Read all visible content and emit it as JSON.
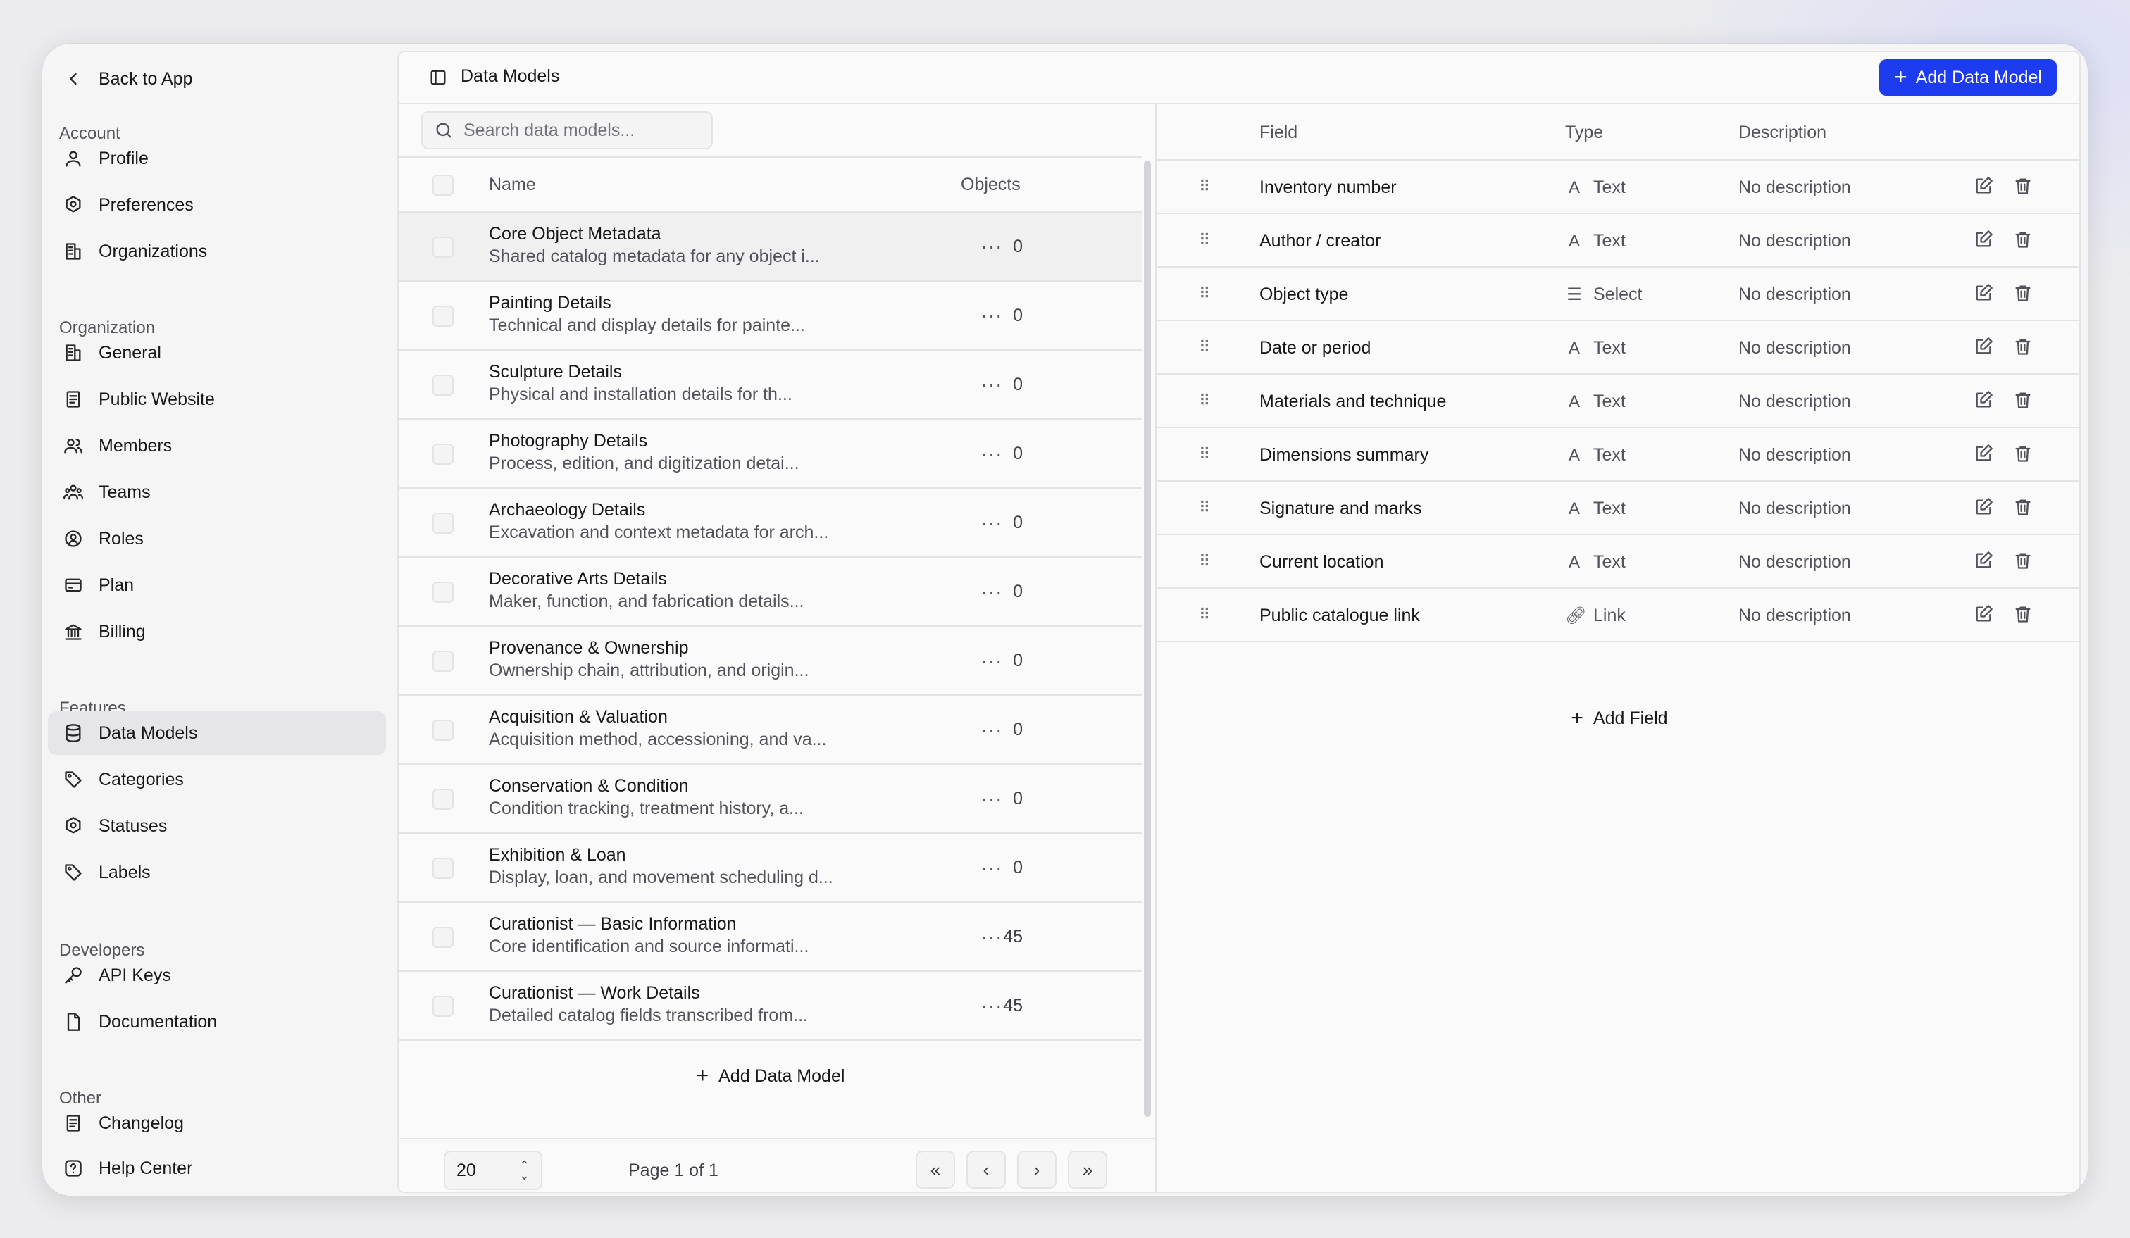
{
  "sidebar": {
    "back_label": "Back to App",
    "sections": [
      {
        "label": "Account",
        "items": [
          {
            "label": "Profile",
            "icon": "user-icon"
          },
          {
            "label": "Preferences",
            "icon": "settings-icon"
          },
          {
            "label": "Organizations",
            "icon": "building-icon"
          }
        ]
      },
      {
        "label": "Organization",
        "items": [
          {
            "label": "General",
            "icon": "building-icon"
          },
          {
            "label": "Public Website",
            "icon": "document-icon"
          },
          {
            "label": "Members",
            "icon": "users-icon"
          },
          {
            "label": "Teams",
            "icon": "team-icon"
          },
          {
            "label": "Roles",
            "icon": "role-icon"
          },
          {
            "label": "Plan",
            "icon": "card-icon"
          },
          {
            "label": "Billing",
            "icon": "bank-icon"
          }
        ]
      },
      {
        "label": "Features",
        "items": [
          {
            "label": "Data Models",
            "icon": "database-icon",
            "active": true
          },
          {
            "label": "Categories",
            "icon": "tag-icon"
          },
          {
            "label": "Statuses",
            "icon": "settings-icon"
          },
          {
            "label": "Labels",
            "icon": "tag-icon"
          }
        ]
      },
      {
        "label": "Developers",
        "items": [
          {
            "label": "API Keys",
            "icon": "key-icon"
          },
          {
            "label": "Documentation",
            "icon": "file-icon"
          }
        ]
      },
      {
        "label": "Other",
        "items": [
          {
            "label": "Changelog",
            "icon": "document-icon"
          },
          {
            "label": "Help Center",
            "icon": "help-icon"
          }
        ]
      }
    ]
  },
  "header": {
    "title": "Data Models",
    "add_button_label": "Add Data Model"
  },
  "list": {
    "search_placeholder": "Search data models...",
    "columns": {
      "name": "Name",
      "objects": "Objects"
    },
    "rows": [
      {
        "name": "Core Object Metadata",
        "description": "Shared catalog metadata for any object i...",
        "objects": "0"
      },
      {
        "name": "Painting Details",
        "description": "Technical and display details for painte...",
        "objects": "0"
      },
      {
        "name": "Sculpture Details",
        "description": "Physical and installation details for th...",
        "objects": "0"
      },
      {
        "name": "Photography Details",
        "description": "Process, edition, and digitization detai...",
        "objects": "0"
      },
      {
        "name": "Archaeology Details",
        "description": "Excavation and context metadata for arch...",
        "objects": "0"
      },
      {
        "name": "Decorative Arts Details",
        "description": "Maker, function, and fabrication details...",
        "objects": "0"
      },
      {
        "name": "Provenance & Ownership",
        "description": "Ownership chain, attribution, and origin...",
        "objects": "0"
      },
      {
        "name": "Acquisition & Valuation",
        "description": "Acquisition method, accessioning, and va...",
        "objects": "0"
      },
      {
        "name": "Conservation & Condition",
        "description": "Condition tracking, treatment history, a...",
        "objects": "0"
      },
      {
        "name": "Exhibition & Loan",
        "description": "Display, loan, and movement scheduling d...",
        "objects": "0"
      },
      {
        "name": "Curationist — Basic Information",
        "description": "Core identification and source informati...",
        "objects": "45"
      },
      {
        "name": "Curationist — Work Details",
        "description": "Detailed catalog fields transcribed from...",
        "objects": "45"
      }
    ],
    "add_row_label": "Add Data Model",
    "pagination": {
      "page_size": "20",
      "page_info": "Page 1 of 1"
    }
  },
  "fields": {
    "columns": {
      "field": "Field",
      "type": "Type",
      "description": "Description"
    },
    "rows": [
      {
        "name": "Inventory number",
        "type": "Text",
        "type_icon": "text-icon",
        "description": "No description"
      },
      {
        "name": "Author / creator",
        "type": "Text",
        "type_icon": "text-icon",
        "description": "No description"
      },
      {
        "name": "Object type",
        "type": "Select",
        "type_icon": "list-icon",
        "description": "No description"
      },
      {
        "name": "Date or period",
        "type": "Text",
        "type_icon": "text-icon",
        "description": "No description"
      },
      {
        "name": "Materials and technique",
        "type": "Text",
        "type_icon": "text-icon",
        "description": "No description"
      },
      {
        "name": "Dimensions summary",
        "type": "Text",
        "type_icon": "text-icon",
        "description": "No description"
      },
      {
        "name": "Signature and marks",
        "type": "Text",
        "type_icon": "text-icon",
        "description": "No description"
      },
      {
        "name": "Current location",
        "type": "Text",
        "type_icon": "text-icon",
        "description": "No description"
      },
      {
        "name": "Public catalogue link",
        "type": "Link",
        "type_icon": "link-icon",
        "description": "No description"
      }
    ],
    "add_field_label": "Add Field"
  },
  "colors": {
    "accent": "#1d3bef",
    "active_nav": "#e6e6e8",
    "border": "#e4e4e7"
  }
}
